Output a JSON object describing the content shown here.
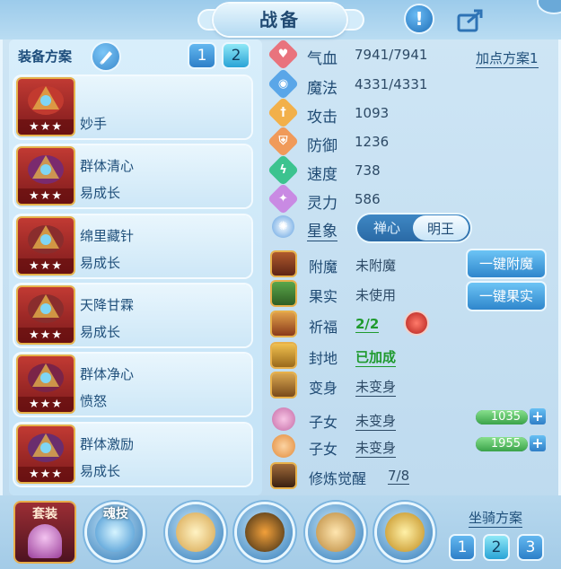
{
  "header": {
    "title": "战备"
  },
  "equip_plan": {
    "label": "装备方案",
    "plans": [
      "1",
      "2"
    ],
    "active_plan": "2"
  },
  "equip_cards": [
    {
      "name": "",
      "sub": "妙手",
      "stars": "★★★",
      "color": "#c23a2f"
    },
    {
      "name": "群体清心",
      "sub": "易成长",
      "stars": "★★★",
      "color": "#7a2a6e"
    },
    {
      "name": "绵里藏针",
      "sub": "易成长",
      "stars": "★★★",
      "color": "#8a2d2d"
    },
    {
      "name": "天降甘霖",
      "sub": "易成长",
      "stars": "★★★",
      "color": "#8a2d2d"
    },
    {
      "name": "群体净心",
      "sub": "愤怒",
      "stars": "★★★",
      "color": "#7a2448"
    },
    {
      "name": "群体激励",
      "sub": "易成长",
      "stars": "★★★",
      "color": "#6a2d6e"
    }
  ],
  "stats": {
    "plus_plan": "加点方案1",
    "rows": [
      {
        "label": "气血",
        "value": "7941/7941",
        "icon": "heart-icon",
        "color": "#e9737d",
        "glyph": "♥"
      },
      {
        "label": "魔法",
        "value": "4331/4331",
        "icon": "magic-icon",
        "color": "#5aa6e8",
        "glyph": "◉"
      },
      {
        "label": "攻击",
        "value": "1093",
        "icon": "sword-icon",
        "color": "#f2b04a",
        "glyph": "†"
      },
      {
        "label": "防御",
        "value": "1236",
        "icon": "shield-icon",
        "color": "#f09a5a",
        "glyph": "⛨"
      },
      {
        "label": "速度",
        "value": "738",
        "icon": "lightning-icon",
        "color": "#3cc38f",
        "glyph": "ϟ"
      },
      {
        "label": "灵力",
        "value": "586",
        "icon": "spirit-icon",
        "color": "#c98ae3",
        "glyph": "✦"
      }
    ]
  },
  "constellation": {
    "label": "星象",
    "options": [
      "禅心",
      "明王"
    ],
    "selected": "明王"
  },
  "enhance": {
    "rows": [
      {
        "label": "附魔",
        "value": "未附魔"
      },
      {
        "label": "果实",
        "value": "未使用"
      },
      {
        "label": "祈福",
        "value": "2/2"
      },
      {
        "label": "封地",
        "value": "已加成"
      },
      {
        "label": "变身",
        "value": "未变身"
      },
      {
        "label": "子女",
        "value": "未变身",
        "bar_value": "1035"
      },
      {
        "label": "子女",
        "value": "未变身",
        "bar_value": "1955"
      },
      {
        "label": "修炼觉醒",
        "value": "7/8"
      }
    ],
    "buttons": {
      "enchant": "一键附魔",
      "fruit": "一键果实"
    }
  },
  "bottom": {
    "suit_label": "套装",
    "soul_label": "魂技",
    "mount_label": "坐骑方案",
    "mount_plans": [
      "1",
      "2",
      "3"
    ],
    "active_mount": "2"
  }
}
